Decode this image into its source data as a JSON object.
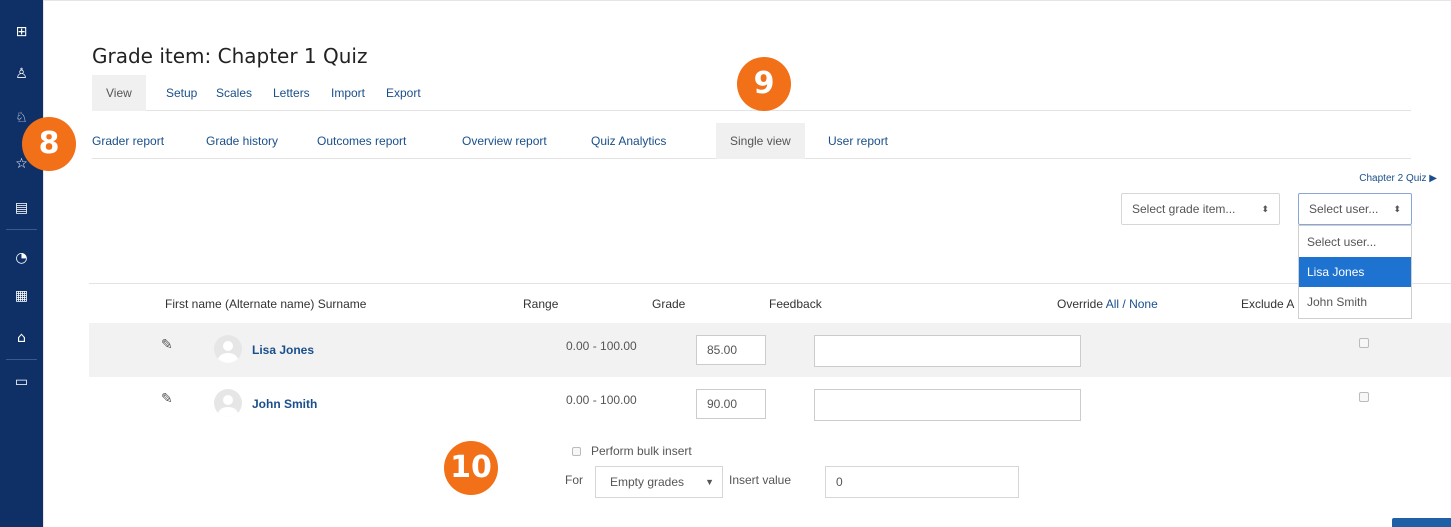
{
  "sidebar": {
    "icons": [
      "dashboard-icon",
      "users-icon",
      "badge-icon",
      "star-icon",
      "document-icon",
      "gauge-icon",
      "calendar-icon",
      "graduation-cap-icon",
      "folder-icon"
    ]
  },
  "page": {
    "title": "Grade item: Chapter 1 Quiz"
  },
  "primary_tabs": [
    "View",
    "Setup",
    "Scales",
    "Letters",
    "Import",
    "Export"
  ],
  "secondary_tabs": [
    "Grader report",
    "Grade history",
    "Outcomes report",
    "Overview report",
    "Quiz Analytics",
    "Single view",
    "User report"
  ],
  "next_link": "Chapter 2 Quiz ▶",
  "select_grade_item": {
    "value": "Select grade item..."
  },
  "select_user": {
    "value": "Select user...",
    "options": [
      "Select user...",
      "Lisa Jones",
      "John Smith"
    ],
    "highlighted": "Lisa Jones"
  },
  "table": {
    "headers": {
      "name": "First name (Alternate name) Surname",
      "range": "Range",
      "grade": "Grade",
      "feedback": "Feedback",
      "override": "Override",
      "override_all": "All",
      "override_sep": "/",
      "override_none": "None",
      "exclude": "Exclude A"
    },
    "rows": [
      {
        "name": "Lisa Jones",
        "range": "0.00 - 100.00",
        "grade": "85.00",
        "feedback": ""
      },
      {
        "name": "John Smith",
        "range": "0.00 - 100.00",
        "grade": "90.00",
        "feedback": ""
      }
    ]
  },
  "bulk": {
    "label": "Perform bulk insert",
    "for_label": "For",
    "for_value": "Empty grades",
    "insert_label": "Insert value",
    "insert_value": "0"
  },
  "callouts": [
    "8",
    "9",
    "10"
  ],
  "colors": {
    "sidebar": "#0f3067",
    "link": "#1a4f8b",
    "callout": "#f27018",
    "highlight": "#1e73d1"
  }
}
